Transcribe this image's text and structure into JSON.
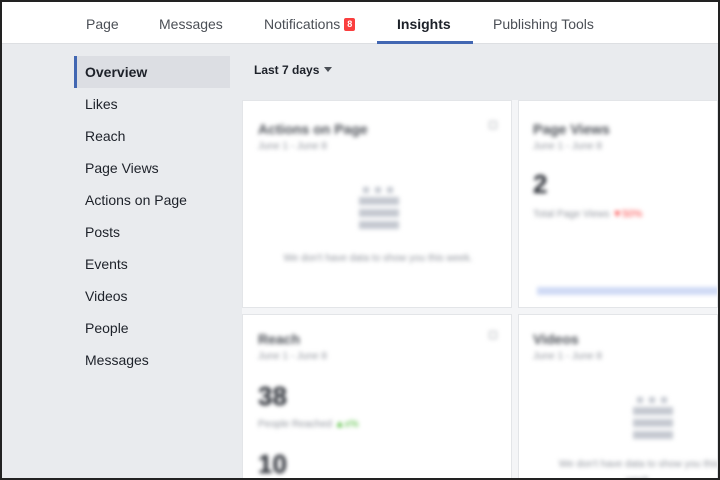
{
  "nav": {
    "tabs": [
      {
        "label": "Page"
      },
      {
        "label": "Messages"
      },
      {
        "label": "Notifications",
        "badge": "8"
      },
      {
        "label": "Insights"
      },
      {
        "label": "Publishing Tools"
      }
    ],
    "active_index": 3,
    "accent": "#4267b2",
    "badge_color": "#fa3e3e"
  },
  "sidebar": {
    "items": [
      {
        "label": "Overview"
      },
      {
        "label": "Likes"
      },
      {
        "label": "Reach"
      },
      {
        "label": "Page Views"
      },
      {
        "label": "Actions on Page"
      },
      {
        "label": "Posts"
      },
      {
        "label": "Events"
      },
      {
        "label": "Videos"
      },
      {
        "label": "People"
      },
      {
        "label": "Messages"
      }
    ],
    "active_index": 0
  },
  "filter": {
    "label": "Last 7 days"
  },
  "cards": {
    "actions": {
      "title": "Actions on Page",
      "date": "June 1 - June 8",
      "note": "We don't have data to show you this week."
    },
    "page_views": {
      "title": "Page Views",
      "date": "June 1 - June 8",
      "value": "2",
      "sub": "Total Page Views",
      "change": "▼50%"
    },
    "reach": {
      "title": "Reach",
      "date": "June 1 - June 8",
      "value": "38",
      "sub": "People Reached",
      "change": "▲x%",
      "value2": "10"
    },
    "videos": {
      "title": "Videos",
      "date": "June 1 - June 8",
      "note": "We don't have data to show you this week."
    }
  }
}
